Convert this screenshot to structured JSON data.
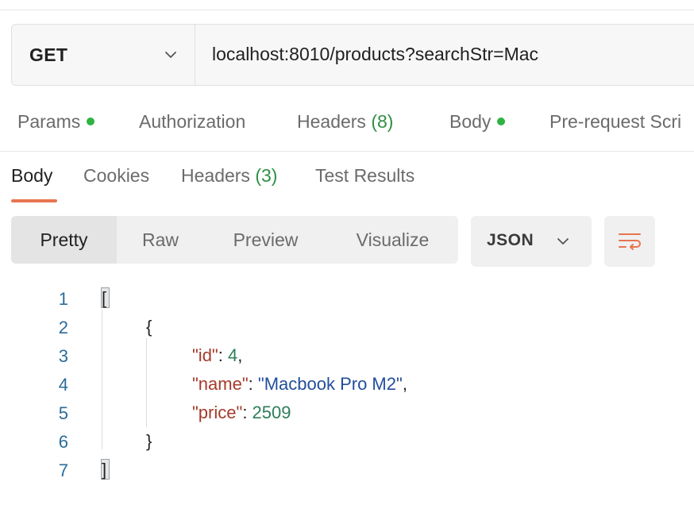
{
  "request": {
    "method": "GET",
    "url": "localhost:8010/products?searchStr=Mac"
  },
  "request_tabs": {
    "params": "Params",
    "authorization": "Authorization",
    "headers": "Headers",
    "headers_count": "(8)",
    "body": "Body",
    "prerequest": "Pre-request Scri"
  },
  "response_tabs": {
    "body": "Body",
    "cookies": "Cookies",
    "headers": "Headers",
    "headers_count": "(3)",
    "test_results": "Test Results"
  },
  "view_modes": {
    "pretty": "Pretty",
    "raw": "Raw",
    "preview": "Preview",
    "visualize": "Visualize"
  },
  "format": "JSON",
  "colors": {
    "accent": "#e8744f",
    "status_dot": "#2fb344",
    "json_key": "#a63a2a",
    "json_number": "#2e7d5b",
    "json_string": "#234e9c",
    "line_number": "#2b6c9b"
  },
  "response_body": {
    "line_numbers": [
      "1",
      "2",
      "3",
      "4",
      "5",
      "6",
      "7"
    ],
    "open_array": "[",
    "open_object": "{",
    "id_key": "\"id\"",
    "id_value": "4",
    "name_key": "\"name\"",
    "name_value": "\"Macbook Pro M2\"",
    "price_key": "\"price\"",
    "price_value": "2509",
    "close_object": "}",
    "close_array": "]"
  }
}
